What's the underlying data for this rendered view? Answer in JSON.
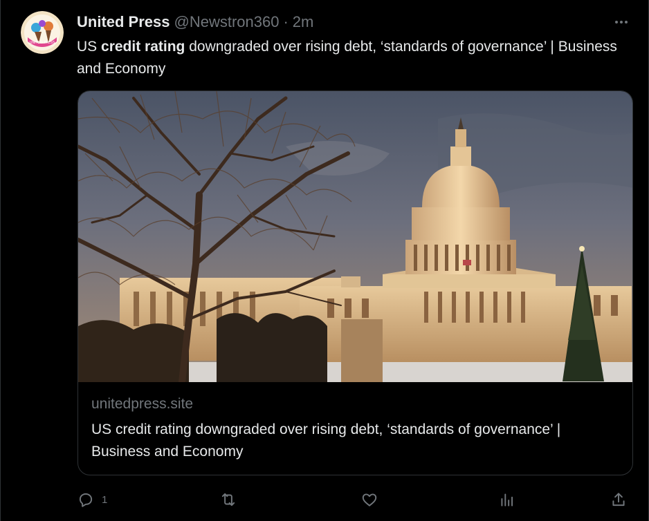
{
  "post": {
    "display_name": "United Press",
    "handle": "@Newstron360",
    "separator": "·",
    "timestamp": "2m",
    "text_before": "US ",
    "text_bold": "credit rating",
    "text_after": " downgraded over rising debt, ‘standards of governance’ | Business and Economy"
  },
  "card": {
    "domain": "unitedpress.site",
    "title": "US credit rating downgraded over rising debt, ‘standards of governance’ | Business and Economy",
    "image_icon": "capitol-building-photo"
  },
  "actions": {
    "reply_count": "1",
    "reply_icon": "reply-icon",
    "repost_icon": "repost-icon",
    "like_icon": "heart-icon",
    "views_icon": "analytics-icon",
    "share_icon": "share-icon"
  },
  "colors": {
    "background": "#000000",
    "primary_text": "#e7e9ea",
    "secondary_text": "#71767b",
    "border": "#2f3336"
  }
}
